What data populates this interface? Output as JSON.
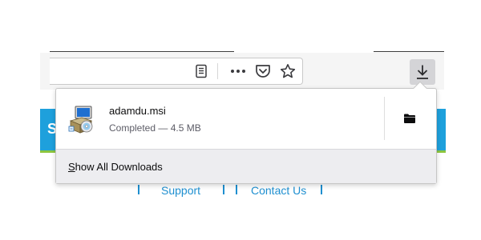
{
  "toolbar": {
    "icons": {
      "reader": "reader-view-icon",
      "more": "page-actions-icon",
      "pocket": "pocket-icon",
      "bookmark": "bookmark-star-icon",
      "downloads": "download-arrow-icon"
    }
  },
  "page": {
    "banner_char": "S",
    "footer_links": [
      {
        "label": "Support"
      },
      {
        "label": "Contact Us"
      }
    ]
  },
  "downloads_panel": {
    "items": [
      {
        "file_name": "adamdu.msi",
        "status": "Completed — 4.5 MB",
        "icon": "installer-package-icon",
        "action_icon": "folder-icon"
      }
    ],
    "show_all_accel": "S",
    "show_all_rest": "how All Downloads"
  },
  "colors": {
    "accent_blue": "#1ea0dc",
    "link_blue": "#1e8fd0",
    "accent_green": "#8cc63f",
    "panel_footer": "#ededf0"
  }
}
